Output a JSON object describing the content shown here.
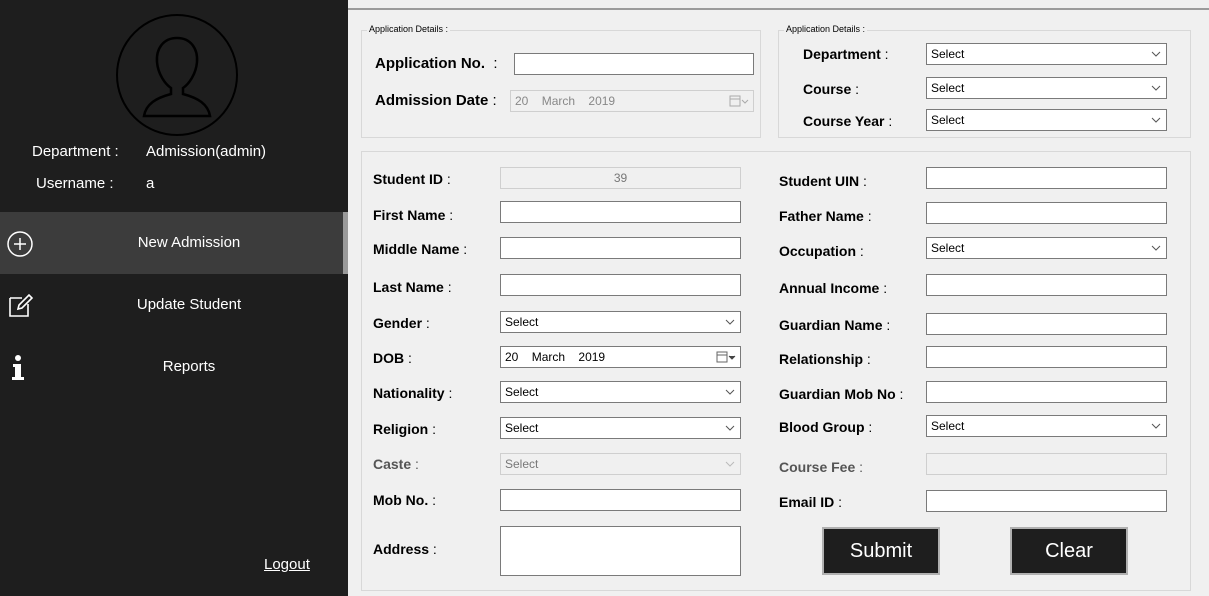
{
  "sidebar": {
    "department_label": "Department :",
    "department_value": "Admission(admin)",
    "username_label": "Username :",
    "username_value": "a",
    "nav": [
      {
        "label": "New Admission",
        "icon": "plus-circle-icon"
      },
      {
        "label": "Update  Student",
        "icon": "edit-icon"
      },
      {
        "label": "Reports",
        "icon": "info-icon"
      }
    ],
    "logout": "Logout"
  },
  "app_group": {
    "title": "Application Details :",
    "application_no_label": "Application No.",
    "application_no_value": "",
    "admission_date_label": "Admission Date",
    "admission_date": {
      "day": "20",
      "month": "March",
      "year": "2019"
    }
  },
  "course_group": {
    "title": "Application Details :",
    "department_label": "Department",
    "department_value": "Select",
    "course_label": "Course",
    "course_value": "Select",
    "course_year_label": "Course Year",
    "course_year_value": "Select"
  },
  "student": {
    "student_id_label": "Student ID",
    "student_id_value": "39",
    "first_name_label": "First Name",
    "first_name_value": "",
    "middle_name_label": "Middle Name",
    "middle_name_value": "",
    "last_name_label": "Last Name",
    "last_name_value": "",
    "gender_label": "Gender",
    "gender_value": "Select",
    "dob_label": "DOB",
    "dob": {
      "day": "20",
      "month": "March",
      "year": "2019"
    },
    "nationality_label": "Nationality",
    "nationality_value": "Select",
    "religion_label": "Religion",
    "religion_value": "Select",
    "caste_label": "Caste",
    "caste_value": "Select",
    "mob_label": "Mob No.",
    "mob_value": "",
    "address_label": "Address",
    "address_value": "",
    "uin_label": "Student UIN",
    "uin_value": "",
    "father_label": "Father Name",
    "father_value": "",
    "occupation_label": "Occupation",
    "occupation_value": "Select",
    "income_label": "Annual Income",
    "income_value": "",
    "guardian_label": "Guardian Name",
    "guardian_value": "",
    "relationship_label": "Relationship",
    "relationship_value": "",
    "guardian_mob_label": "Guardian Mob No",
    "guardian_mob_value": "",
    "blood_label": "Blood Group",
    "blood_value": "Select",
    "fee_label": "Course Fee",
    "fee_value": "",
    "email_label": "Email ID",
    "email_value": ""
  },
  "actions": {
    "submit": "Submit",
    "clear": "Clear"
  },
  "colors": {
    "sidebar_bg": "#1e1e1e",
    "nav_active_bg": "#3c3c3c",
    "form_bg": "#f0f0f0"
  }
}
